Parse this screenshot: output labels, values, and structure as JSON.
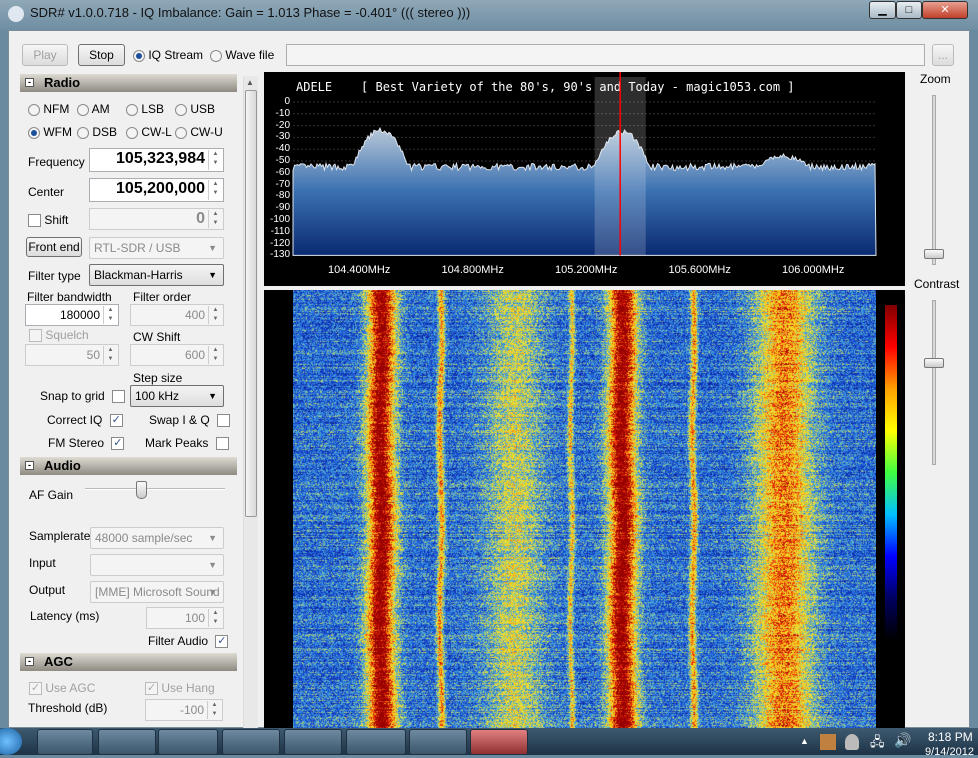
{
  "window": {
    "title": "SDR# v1.0.0.718 - IQ Imbalance: Gain = 1.013 Phase = -0.401° ((( stereo )))",
    "minimize": "▁",
    "maximize": "□",
    "close": "✕"
  },
  "toolbar": {
    "play": "Play",
    "stop": "Stop",
    "iq_stream": "IQ Stream",
    "wave_file": "Wave file",
    "file_path": "",
    "browse": "..."
  },
  "radio": {
    "header": "Radio",
    "modes": [
      {
        "label": "NFM",
        "on": false
      },
      {
        "label": "AM",
        "on": false
      },
      {
        "label": "LSB",
        "on": false
      },
      {
        "label": "USB",
        "on": false
      },
      {
        "label": "WFM",
        "on": true
      },
      {
        "label": "DSB",
        "on": false
      },
      {
        "label": "CW-L",
        "on": false
      },
      {
        "label": "CW-U",
        "on": false
      }
    ],
    "frequency_label": "Frequency",
    "frequency": "105,323,984",
    "center_label": "Center",
    "center": "105,200,000",
    "shift_label": "Shift",
    "shift": "0",
    "front_end": "Front end",
    "front_end_device": "RTL-SDR / USB",
    "filter_type_label": "Filter type",
    "filter_type": "Blackman-Harris",
    "filter_bandwidth_label": "Filter bandwidth",
    "filter_bandwidth": "180000",
    "filter_order_label": "Filter order",
    "filter_order": "400",
    "squelch_label": "Squelch",
    "squelch": "50",
    "cw_shift_label": "CW Shift",
    "cw_shift": "600",
    "step_size_label": "Step size",
    "step_size": "100 kHz",
    "snap_to_grid": "Snap to grid",
    "correct_iq": "Correct IQ",
    "swap_iq": "Swap I & Q",
    "fm_stereo": "FM Stereo",
    "mark_peaks": "Mark Peaks"
  },
  "audio": {
    "header": "Audio",
    "af_gain_label": "AF Gain",
    "af_gain_level": 0.4,
    "samplerate_label": "Samplerate",
    "samplerate": "48000 sample/sec",
    "input_label": "Input",
    "input": "",
    "output_label": "Output",
    "output": "[MME] Microsoft Sound",
    "latency_label": "Latency (ms)",
    "latency": "100",
    "filter_audio": "Filter Audio"
  },
  "agc": {
    "header": "AGC",
    "use_agc": "Use AGC",
    "use_hang": "Use Hang",
    "threshold_label": "Threshold (dB)",
    "threshold": "-100"
  },
  "spectrum": {
    "rds_text": "ADELE    [ Best Variety of the 80's, 90's and Today - magic1053.com ]",
    "db_ticks": [
      "0",
      "-10",
      "-20",
      "-30",
      "-40",
      "-50",
      "-60",
      "-70",
      "-80",
      "-90",
      "-100",
      "-110",
      "-120",
      "-130"
    ],
    "freq_ticks": [
      "104.400MHz",
      "104.800MHz",
      "105.200MHz",
      "105.600MHz",
      "106.000MHz"
    ],
    "tuned_mhz": 105.323984,
    "center_mhz": 105.2,
    "bandwidth_khz": 180,
    "colors": {
      "cursor": "#ff0000",
      "trace": "#dfe6ee"
    }
  },
  "side": {
    "zoom": "Zoom",
    "contrast": "Contrast",
    "zoom_level": 0.05,
    "contrast_level": 0.6
  },
  "taskbar": {
    "time": "8:18 PM",
    "date": "9/14/2012"
  }
}
